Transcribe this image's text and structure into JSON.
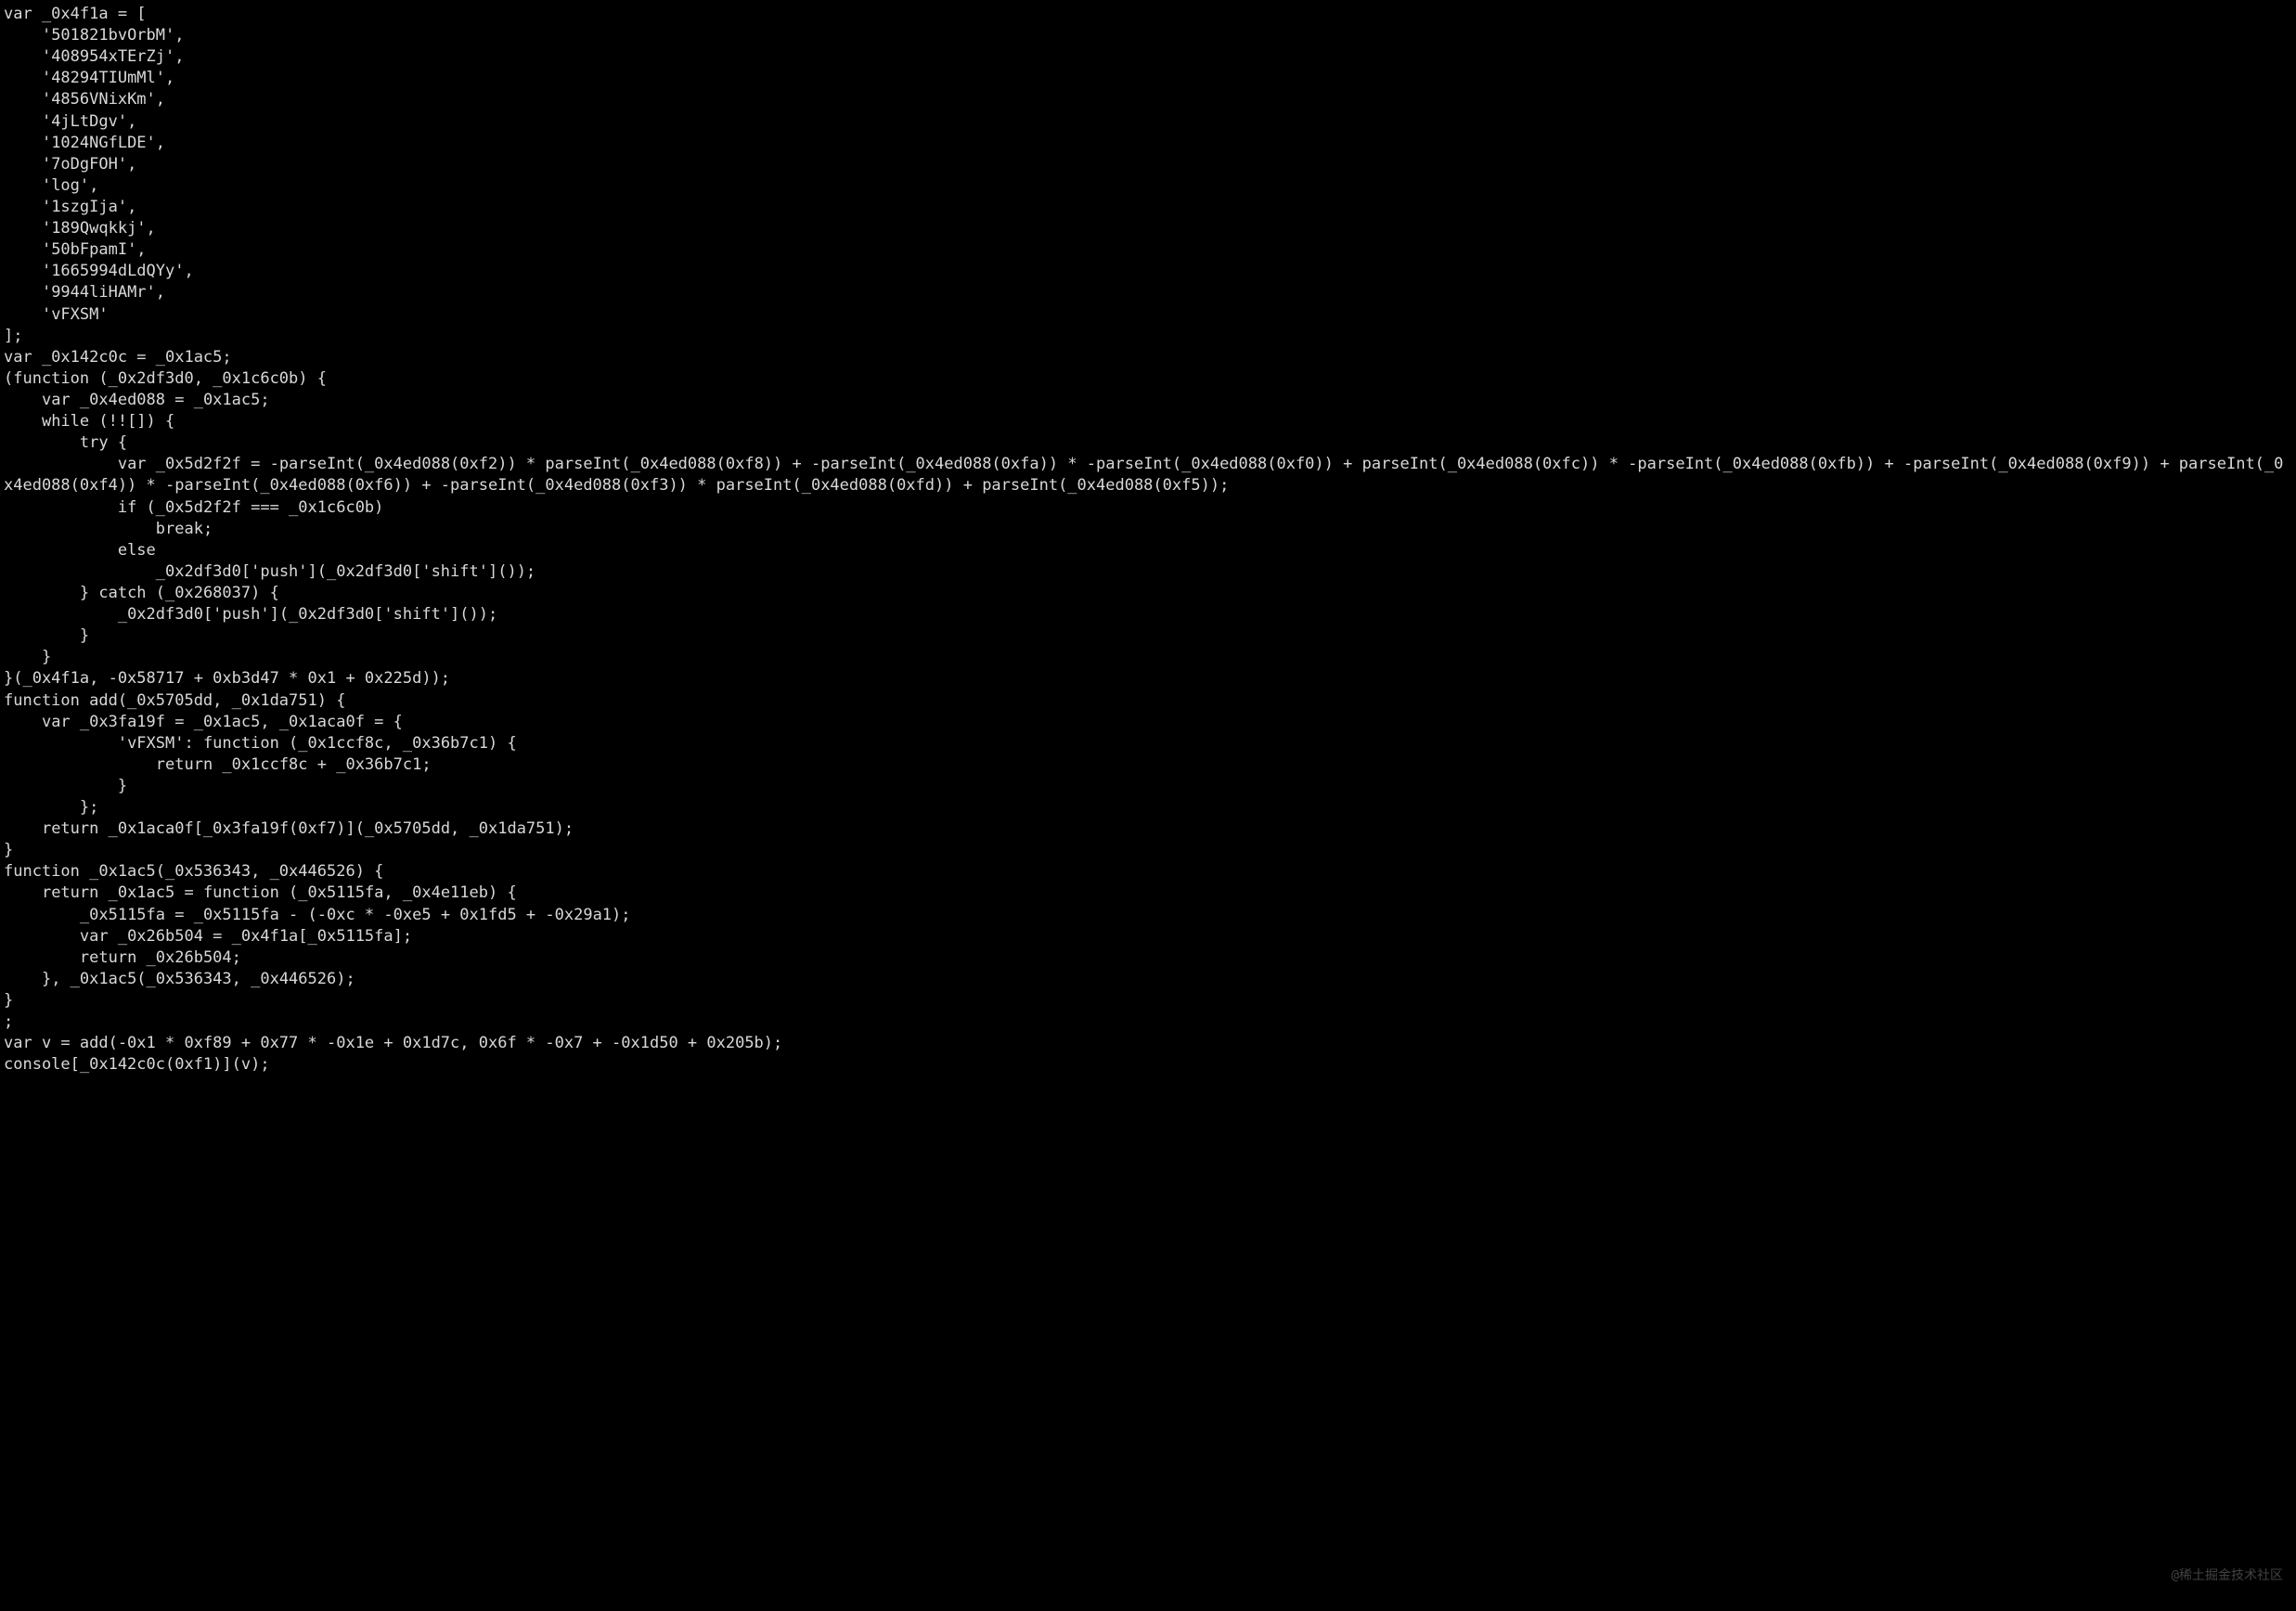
{
  "code": "var _0x4f1a = [\n    '501821bvOrbM',\n    '408954xTErZj',\n    '48294TIUmMl',\n    '4856VNixKm',\n    '4jLtDgv',\n    '1024NGfLDE',\n    '7oDgFOH',\n    'log',\n    '1szgIja',\n    '189Qwqkkj',\n    '50bFpamI',\n    '1665994dLdQYy',\n    '9944liHAMr',\n    'vFXSM'\n];\nvar _0x142c0c = _0x1ac5;\n(function (_0x2df3d0, _0x1c6c0b) {\n    var _0x4ed088 = _0x1ac5;\n    while (!![]) {\n        try {\n            var _0x5d2f2f = -parseInt(_0x4ed088(0xf2)) * parseInt(_0x4ed088(0xf8)) + -parseInt(_0x4ed088(0xfa)) * -parseInt(_0x4ed088(0xf0)) + parseInt(_0x4ed088(0xfc)) * -parseInt(_0x4ed088(0xfb)) + -parseInt(_0x4ed088(0xf9)) + parseInt(_0x4ed088(0xf4)) * -parseInt(_0x4ed088(0xf6)) + -parseInt(_0x4ed088(0xf3)) * parseInt(_0x4ed088(0xfd)) + parseInt(_0x4ed088(0xf5));\n            if (_0x5d2f2f === _0x1c6c0b)\n                break;\n            else\n                _0x2df3d0['push'](_0x2df3d0['shift']());\n        } catch (_0x268037) {\n            _0x2df3d0['push'](_0x2df3d0['shift']());\n        }\n    }\n}(_0x4f1a, -0x58717 + 0xb3d47 * 0x1 + 0x225d));\nfunction add(_0x5705dd, _0x1da751) {\n    var _0x3fa19f = _0x1ac5, _0x1aca0f = {\n            'vFXSM': function (_0x1ccf8c, _0x36b7c1) {\n                return _0x1ccf8c + _0x36b7c1;\n            }\n        };\n    return _0x1aca0f[_0x3fa19f(0xf7)](_0x5705dd, _0x1da751);\n}\nfunction _0x1ac5(_0x536343, _0x446526) {\n    return _0x1ac5 = function (_0x5115fa, _0x4e11eb) {\n        _0x5115fa = _0x5115fa - (-0xc * -0xe5 + 0x1fd5 + -0x29a1);\n        var _0x26b504 = _0x4f1a[_0x5115fa];\n        return _0x26b504;\n    }, _0x1ac5(_0x536343, _0x446526);\n}\n;\nvar v = add(-0x1 * 0xf89 + 0x77 * -0x1e + 0x1d7c, 0x6f * -0x7 + -0x1d50 + 0x205b);\nconsole[_0x142c0c(0xf1)](v);",
  "watermark": "@稀土掘金技术社区"
}
